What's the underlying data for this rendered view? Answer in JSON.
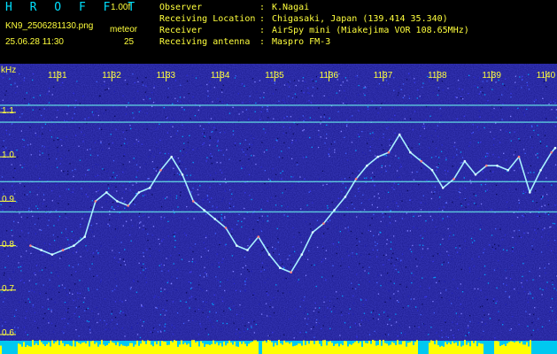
{
  "header": {
    "logo": "H R O F F T",
    "version": "1.00f",
    "filename": "KN9_250628113​0.png",
    "timestamp": "25.06.28 11:30",
    "meteor_label": "meteor",
    "meteor_count": "25",
    "info_rows": [
      {
        "key": "Observer",
        "value": "K.Nagai"
      },
      {
        "key": "Receiving Location",
        "value": "Chigasaki, Japan (139.414 35.340)"
      },
      {
        "key": "Receiver",
        "value": "AirSpy mini (Miakejima VOR 108.65MHz)"
      },
      {
        "key": "Receiving antenna",
        "value": "Maspro FM-3"
      }
    ]
  },
  "axis": {
    "ylabel": "kHz",
    "yticks": [
      "1.1",
      "1.0",
      "0.9",
      "0.8",
      "0.7",
      "0.6"
    ],
    "xticks": [
      "1131",
      "1132",
      "1133",
      "1134",
      "1135",
      "1136",
      "1137",
      "1138",
      "1139",
      "1140"
    ]
  },
  "colors": {
    "background": "#000000",
    "noise_field": "#1a1a8c",
    "text": "#ffff3c",
    "logo": "#00e0ff",
    "carrier_line": "#66e8e8",
    "trace": "#9fe8ff",
    "bottom_band_yellow": "#ffff00",
    "bottom_band_cyan": "#00d8ff"
  },
  "chart_data": {
    "type": "line",
    "xlabel": "",
    "ylabel": "kHz",
    "xlim": [
      1130.5,
      1140.3
    ],
    "ylim": [
      0.59,
      1.2
    ],
    "horizontal_lines": [
      1.116,
      1.078,
      0.944,
      0.876
    ],
    "series": [
      {
        "x": [
          1130.5,
          1130.7,
          1130.9,
          1131.1,
          1131.3,
          1131.5,
          1131.7,
          1131.9,
          1132.1,
          1132.3,
          1132.5,
          1132.7,
          1132.9,
          1133.1,
          1133.3,
          1133.5,
          1133.7,
          1133.9,
          1134.1,
          1134.3,
          1134.5,
          1134.7,
          1134.9,
          1135.1,
          1135.3,
          1135.5,
          1135.7,
          1135.9,
          1136.1,
          1136.3,
          1136.5,
          1136.7,
          1136.9,
          1137.1,
          1137.3,
          1137.5,
          1137.7,
          1137.9,
          1138.1,
          1138.3,
          1138.5,
          1138.7,
          1138.9,
          1139.1,
          1139.3,
          1139.5,
          1139.7,
          1139.9,
          1140.1,
          1140.3
        ],
        "y": [
          0.8,
          0.79,
          0.78,
          0.79,
          0.8,
          0.82,
          0.9,
          0.92,
          0.9,
          0.89,
          0.92,
          0.93,
          0.97,
          1.0,
          0.96,
          0.9,
          0.88,
          0.86,
          0.84,
          0.8,
          0.79,
          0.82,
          0.78,
          0.75,
          0.74,
          0.78,
          0.83,
          0.85,
          0.88,
          0.91,
          0.95,
          0.98,
          1.0,
          1.01,
          1.05,
          1.01,
          0.99,
          0.97,
          0.93,
          0.95,
          0.99,
          0.96,
          0.98,
          0.98,
          0.97,
          1.0,
          0.92,
          0.97,
          1.01,
          1.02
        ]
      }
    ]
  }
}
